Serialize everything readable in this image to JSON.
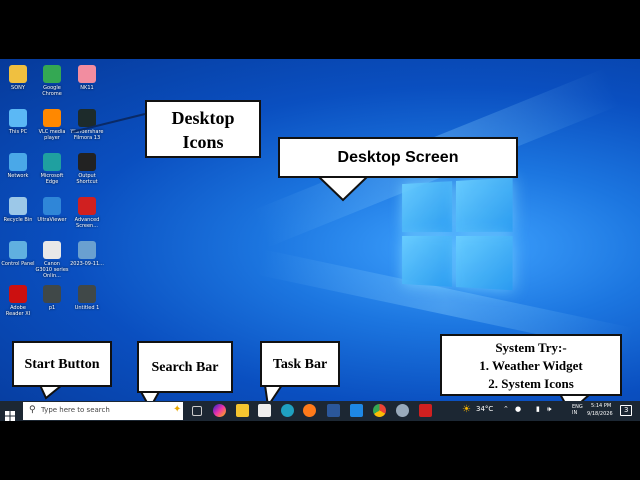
{
  "desktop_icons": [
    {
      "label": "SONY",
      "icon": "user-folder-icon",
      "color": "#f0c040"
    },
    {
      "label": "Google Chrome",
      "icon": "chrome-icon",
      "color": "#34a853"
    },
    {
      "label": "NK11",
      "icon": "file-icon",
      "color": "#f28da0"
    },
    {
      "label": "This PC",
      "icon": "computer-icon",
      "color": "#5bb8f5"
    },
    {
      "label": "VLC media player",
      "icon": "vlc-icon",
      "color": "#ff8800"
    },
    {
      "label": "Wondershare Filmora 13",
      "icon": "filmora-icon",
      "color": "#1d2b2b"
    },
    {
      "label": "Network",
      "icon": "network-icon",
      "color": "#4aa8e8"
    },
    {
      "label": "Microsoft Edge",
      "icon": "edge-icon",
      "color": "#1fa0a0"
    },
    {
      "label": "Output Shortcut",
      "icon": "folder-icon",
      "color": "#222222"
    },
    {
      "label": "Recycle Bin",
      "icon": "recycle-bin-icon",
      "color": "#9cc8e8"
    },
    {
      "label": "UltraViewer",
      "icon": "ultraviewer-icon",
      "color": "#2f86d8"
    },
    {
      "label": "Advanced Screen...",
      "icon": "recorder-icon",
      "color": "#d02020"
    },
    {
      "label": "Control Panel",
      "icon": "control-panel-icon",
      "color": "#60b0e0"
    },
    {
      "label": "Canon G3010 series Onlin...",
      "icon": "canon-icon",
      "color": "#e8e8e8"
    },
    {
      "label": "2023-09-11...",
      "icon": "image-icon",
      "color": "#6aa0d0"
    },
    {
      "label": "Adobe Reader XI",
      "icon": "adobe-reader-icon",
      "color": "#cc1010"
    },
    {
      "label": "p1",
      "icon": "document-icon",
      "color": "#404848"
    },
    {
      "label": "Untitled 1",
      "icon": "document-icon",
      "color": "#404848"
    }
  ],
  "callouts": {
    "desktop_icons": "Desktop Icons",
    "desktop_screen": "Desktop Screen",
    "start_button": "Start Button",
    "search_bar": "Search Bar",
    "task_bar": "Task Bar",
    "system_tray": [
      "System Try:-",
      "1. Weather Widget",
      "2. System Icons"
    ]
  },
  "taskbar": {
    "search_placeholder": "Type here to search",
    "weather": "34°C",
    "language": "ENG IN",
    "time": "5:14 PM",
    "date": "9/18/2026",
    "notification_count": "3"
  }
}
